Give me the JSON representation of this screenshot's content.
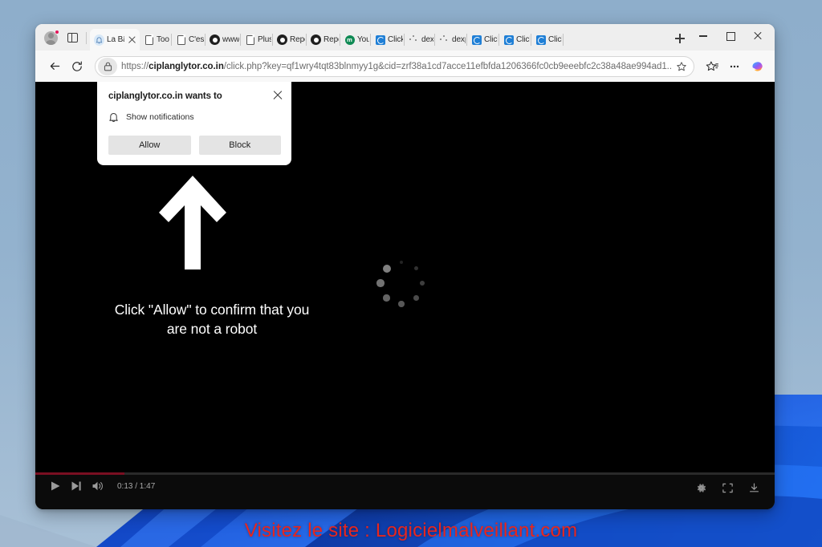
{
  "window": {
    "controls": {
      "minimize": "minimize-button",
      "maximize": "maximize-button",
      "close": "close-button"
    }
  },
  "tabstrip": {
    "tabs": [
      {
        "title": "La Bä",
        "icon": "bell-icon",
        "active": true,
        "has_close": true
      },
      {
        "title": "Too",
        "icon": "document-icon",
        "active": false
      },
      {
        "title": "C'est",
        "icon": "document-icon",
        "active": false
      },
      {
        "title": "www",
        "icon": "dark-circle-icon",
        "active": false
      },
      {
        "title": "Plus",
        "icon": "document-icon",
        "active": false
      },
      {
        "title": "Repç",
        "icon": "dark-circle-icon",
        "active": false
      },
      {
        "title": "Repç",
        "icon": "dark-circle-icon",
        "active": false
      },
      {
        "title": "Youş",
        "icon": "green-badge-icon",
        "active": false
      },
      {
        "title": "Click",
        "icon": "blue-refresh-icon",
        "active": false
      },
      {
        "title": "dexp",
        "icon": "dots-icon",
        "active": false
      },
      {
        "title": "dexp",
        "icon": "dots-icon",
        "active": false
      },
      {
        "title": "Click",
        "icon": "blue-refresh-icon",
        "active": false
      },
      {
        "title": "Click",
        "icon": "blue-refresh-icon",
        "active": false
      },
      {
        "title": "Click",
        "icon": "blue-refresh-icon",
        "active": false
      }
    ],
    "new_tab_label": "+",
    "profile_icon": "profile-avatar-icon",
    "tab_search_icon": "tab-search-icon"
  },
  "toolbar": {
    "back_icon": "back-arrow-icon",
    "reload_icon": "reload-icon",
    "lock_icon": "lock-icon",
    "url_scheme": "https://",
    "url_host": "ciplanglytor.co.in",
    "url_path": "/click.php?key=qf1wry4tqt83blnmyy1g&cid=zrf38a1cd7acce11efbfda1206366fc0cb9eeebfc2c38a48ae994ad1...",
    "favorite_icon": "star-icon",
    "collections_icon": "collections-icon",
    "settings_icon": "more-options-icon",
    "copilot_icon": "copilot-icon"
  },
  "permission_dialog": {
    "title": "ciplanglytor.co.in wants to",
    "permission_icon": "bell-icon",
    "permission_label": "Show notifications",
    "allow_label": "Allow",
    "block_label": "Block",
    "close_icon": "close-icon"
  },
  "page": {
    "arrow_icon": "up-arrow-icon",
    "headline_line1": "Click \"Allow\" to confirm that you",
    "headline_line2": "are not a robot",
    "spinner_icon": "loading-spinner-icon",
    "background_color": "#000000"
  },
  "player": {
    "play_icon": "play-icon",
    "next_icon": "next-track-icon",
    "volume_icon": "volume-icon",
    "time_label": "0:13 / 1:47",
    "current_time": "0:13",
    "duration": "1:47",
    "progress_percent": 12,
    "settings_icon": "gear-icon",
    "fullscreen_icon": "fullscreen-icon",
    "download_icon": "download-icon",
    "progress_color": "#7a0f22"
  },
  "banner": {
    "text": "Visitez le site : Logicielmalveillant.com",
    "color": "#e8261f"
  }
}
